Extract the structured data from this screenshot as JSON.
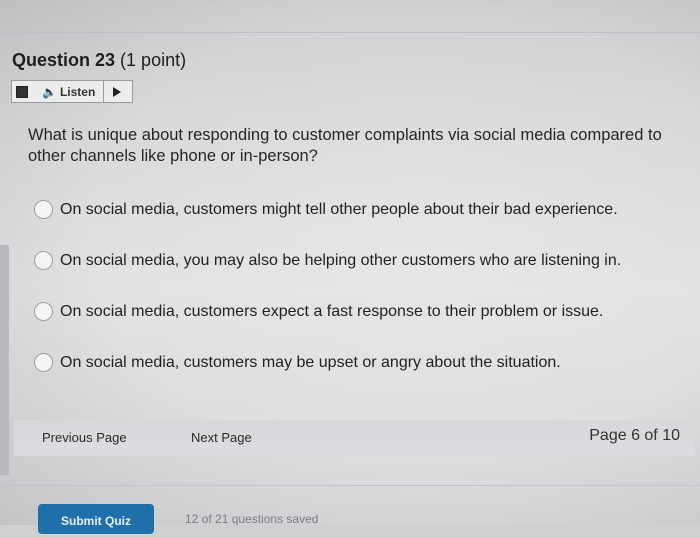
{
  "question": {
    "number_label": "Question 23",
    "points_label": "(1 point)",
    "text": "What is unique about responding to customer complaints via social media compared to other channels like phone or in-person?"
  },
  "listen": {
    "label": "Listen",
    "icons": [
      "stop-icon",
      "speaker-icon",
      "play-icon"
    ]
  },
  "options": [
    {
      "label": "On social media, customers might tell other people about their bad experience.",
      "selected": false
    },
    {
      "label": "On social media, you may also be helping other customers who are listening in.",
      "selected": false
    },
    {
      "label": "On social media, customers expect a fast response to their problem or issue.",
      "selected": false
    },
    {
      "label": "On social media, customers may be upset or angry about the situation.",
      "selected": false
    }
  ],
  "navigation": {
    "previous_label": "Previous Page",
    "next_label": "Next Page",
    "page_indicator": "Page 6 of 10"
  },
  "footer": {
    "submit_label": "Submit Quiz",
    "saved_status": "12 of 21 questions saved"
  },
  "colors": {
    "submit_button": "#1f6fa8",
    "background": "#dcdde0"
  }
}
